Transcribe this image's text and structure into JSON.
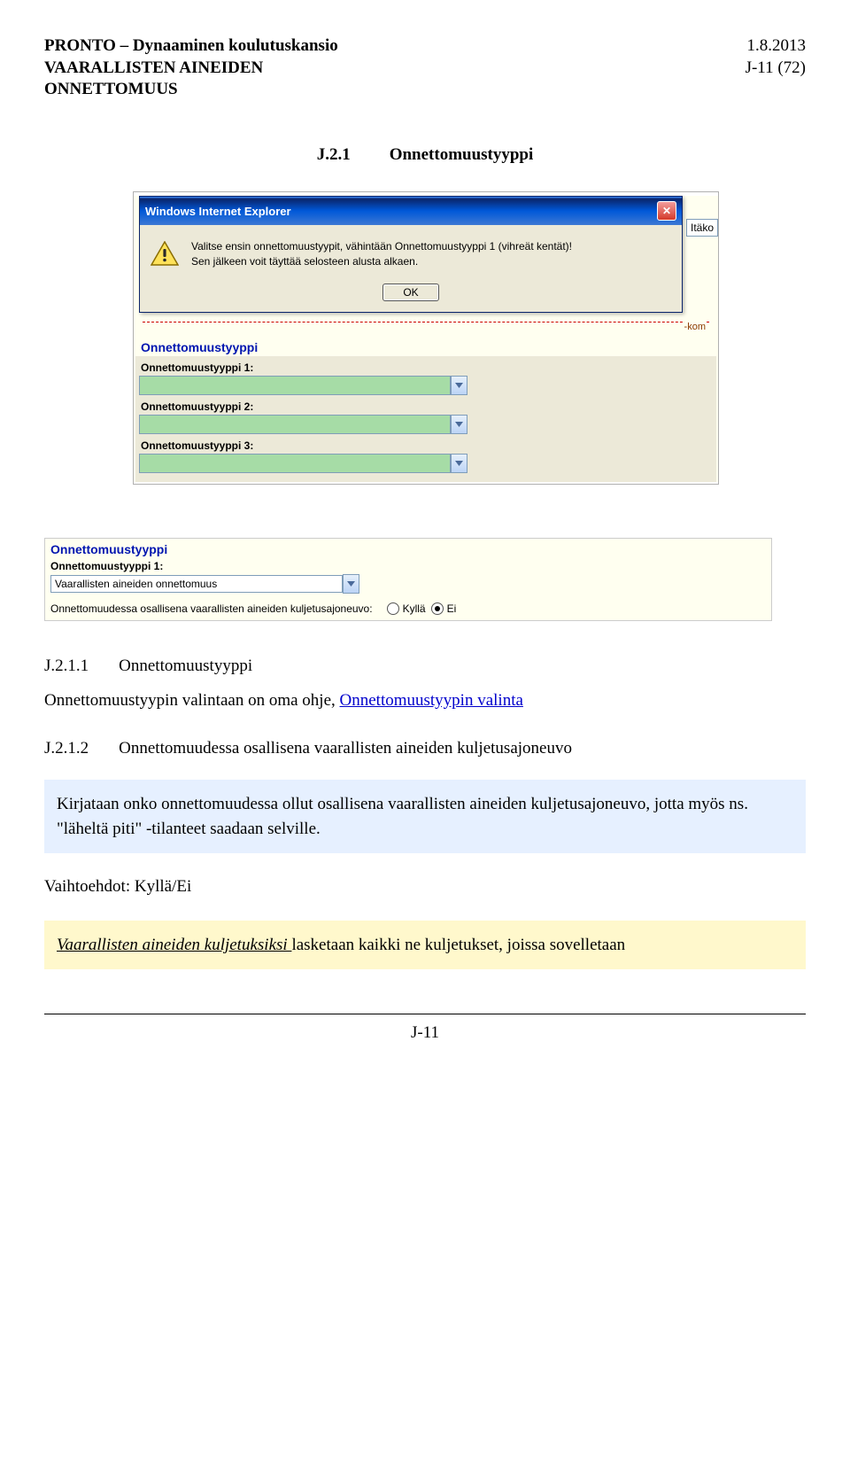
{
  "header": {
    "left_line1": "PRONTO – Dynaaminen koulutuskansio",
    "left_line2": "VAARALLISTEN AINEIDEN",
    "left_line3": "ONNETTOMUUS",
    "right_line1": "1.8.2013",
    "right_line2": "J-11 (72)"
  },
  "section": {
    "number": "J.2.1",
    "title": "Onnettomuustyyppi"
  },
  "dialog": {
    "window_title": "Windows Internet Explorer",
    "line1": "Valitse ensin onnettomuustyypit, vähintään Onnettomuustyyppi 1 (vihreät kentät)!",
    "line2": "Sen jälkeen voit täyttää selosteen alusta alkaen.",
    "ok": "OK",
    "itako": "Itäko",
    "kom": "-kom"
  },
  "form1": {
    "title": "Onnettomuustyyppi",
    "row1": "Onnettomuustyyppi 1:",
    "row2": "Onnettomuustyyppi 2:",
    "row3": "Onnettomuustyyppi 3:"
  },
  "form2": {
    "title": "Onnettomuustyyppi",
    "row1_label": "Onnettomuustyyppi 1:",
    "row1_value": "Vaarallisten aineiden onnettomuus",
    "question": "Onnettomuudessa osallisena vaarallisten aineiden kuljetusajoneuvo:",
    "opt_yes": "Kyllä",
    "opt_no": "Ei"
  },
  "sub1": {
    "number": "J.2.1.1",
    "title": "Onnettomuustyyppi",
    "para_lead": "Onnettomuustyypin valintaan on oma ohje, ",
    "para_link": "Onnettomuustyypin valinta"
  },
  "sub2": {
    "number": "J.2.1.2",
    "title": "Onnettomuudessa osallisena vaarallisten aineiden kuljetusajoneuvo"
  },
  "bluebox": {
    "text": "Kirjataan onko onnettomuudessa ollut osallisena vaarallisten aineiden kuljetusajoneuvo, jotta myös ns. \"läheltä piti\" -tilanteet saadaan selville."
  },
  "options_label": "Vaihtoehdot: Kyllä/Ei",
  "yellowbox": {
    "lead_ital": "Vaarallisten aineiden kuljetuksiksi ",
    "rest": "lasketaan kaikki ne kuljetukset, joissa sovelletaan"
  },
  "footer": "J-11"
}
